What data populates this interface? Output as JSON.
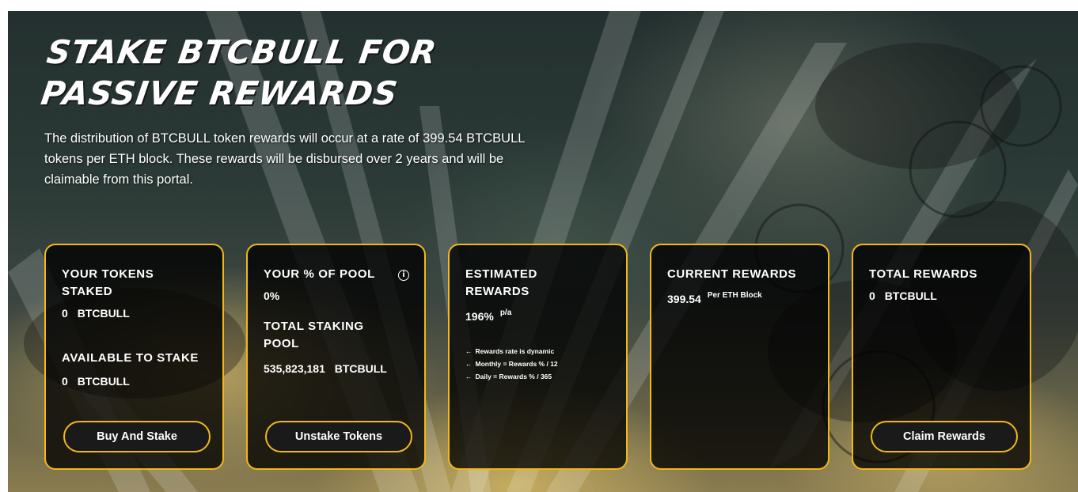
{
  "hero": {
    "title": "Stake BTCBULL for passive rewards",
    "description": "The distribution of BTCBULL token rewards will occur at a rate of 399.54 BTCBULL tokens per ETH block. These rewards will be disbursed over 2 years and will be claimable from this portal."
  },
  "cards": {
    "tokens_staked": {
      "label": "YOUR TOKENS STAKED",
      "value": "0",
      "unit": "BTCBULL",
      "available_label": "AVAILABLE TO STAKE",
      "available_value": "0",
      "available_unit": "BTCBULL",
      "button": "Buy And Stake"
    },
    "pool": {
      "label": "YOUR % OF POOL",
      "info_icon": "i",
      "value": "0%",
      "total_label": "TOTAL STAKING POOL",
      "total_value": "535,823,181",
      "total_unit": "BTCBULL",
      "button": "Unstake Tokens"
    },
    "estimated": {
      "label": "ESTIMATED REWARDS",
      "value": "196%",
      "suffix": "p/a",
      "notes": [
        "Rewards rate is dynamic",
        "Monthly = Rewards % / 12",
        "Daily = Rewards % / 365"
      ],
      "arrow": "←"
    },
    "current": {
      "label": "CURRENT REWARDS",
      "value": "399.54",
      "suffix": "Per ETH Block"
    },
    "total": {
      "label": "TOTAL REWARDS",
      "value": "0",
      "unit": "BTCBULL",
      "button": "Claim Rewards"
    }
  },
  "colors": {
    "accent": "#f2b817",
    "card_bg": "#000000",
    "text": "#ffffff"
  }
}
